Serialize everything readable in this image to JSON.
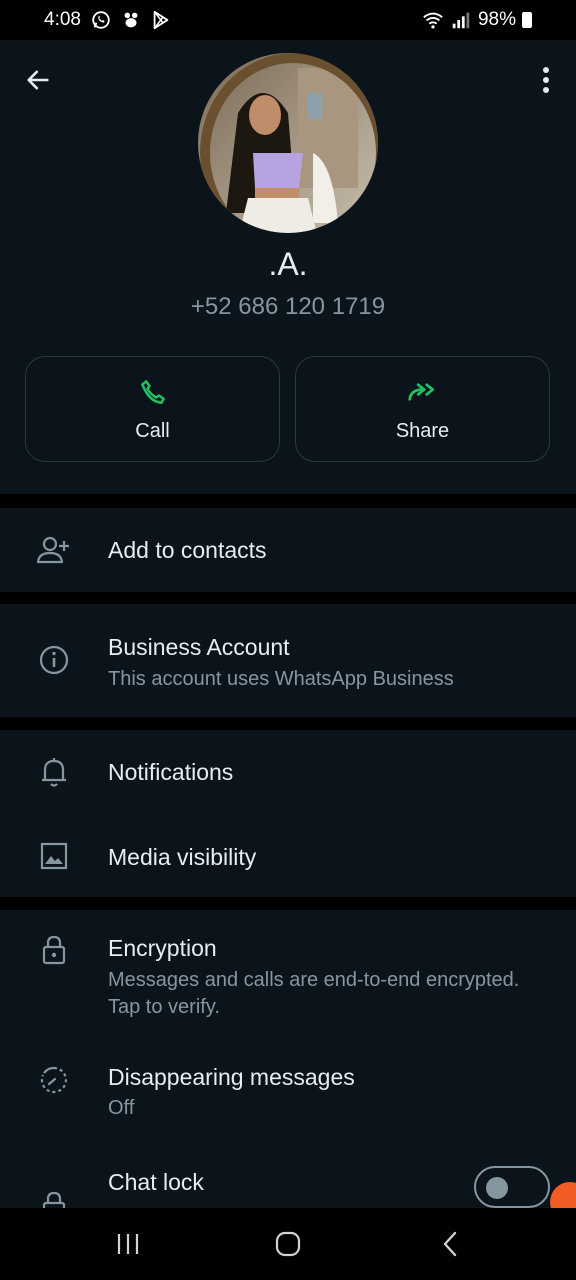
{
  "status_bar": {
    "time": "4:08",
    "left_icons": [
      "whatsapp-icon",
      "app-icon",
      "play-store-icon"
    ],
    "battery": "98%",
    "right_icons": [
      "wifi-icon",
      "signal-icon",
      "battery-icon"
    ]
  },
  "header": {
    "back_icon": "arrow-left-icon",
    "menu_icon": "more-vertical-icon"
  },
  "profile": {
    "name": ".A.",
    "phone": "+52 686 120 1719"
  },
  "actions": [
    {
      "label": "Call",
      "icon": "phone-icon",
      "color": "#21c063"
    },
    {
      "label": "Share",
      "icon": "share-forward-icon",
      "color": "#21c063"
    }
  ],
  "rows": {
    "add_contacts": {
      "title": "Add to contacts",
      "icon": "add-person-icon"
    },
    "business": {
      "title": "Business Account",
      "subtitle": "This account uses WhatsApp Business",
      "icon": "info-icon"
    },
    "notifications": {
      "title": "Notifications",
      "icon": "bell-icon"
    },
    "media": {
      "title": "Media visibility",
      "icon": "image-icon"
    },
    "encryption": {
      "title": "Encryption",
      "subtitle": "Messages and calls are end-to-end encrypted. Tap to verify.",
      "icon": "lock-icon"
    },
    "disappearing": {
      "title": "Disappearing messages",
      "subtitle": "Off",
      "icon": "timer-icon"
    },
    "chat_lock": {
      "title": "Chat lock",
      "icon": "lock-icon",
      "toggle_on": false
    }
  },
  "colors": {
    "background": "#0b141a",
    "accent": "#21c063",
    "secondary_text": "#8696a0"
  },
  "nav": [
    "recent-apps-icon",
    "home-icon",
    "back-icon"
  ]
}
